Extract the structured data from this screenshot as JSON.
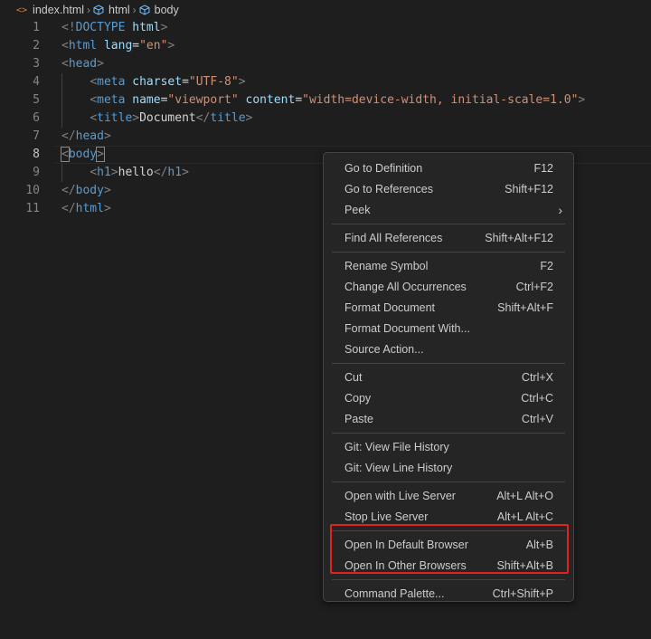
{
  "breadcrumb": {
    "file": "index.html",
    "items": [
      "html",
      "body"
    ]
  },
  "editor": {
    "line_numbers": [
      "1",
      "2",
      "3",
      "4",
      "5",
      "6",
      "7",
      "8",
      "9",
      "10",
      "11"
    ],
    "lines": [
      [
        [
          "p",
          "<!"
        ],
        [
          "t",
          "DOCTYPE"
        ],
        [
          "x",
          " "
        ],
        [
          "a",
          "html"
        ],
        [
          "p",
          ">"
        ]
      ],
      [
        [
          "p",
          "<"
        ],
        [
          "t",
          "html"
        ],
        [
          "x",
          " "
        ],
        [
          "a",
          "lang"
        ],
        [
          "x",
          "="
        ],
        [
          "s",
          "\"en\""
        ],
        [
          "p",
          ">"
        ]
      ],
      [
        [
          "p",
          "<"
        ],
        [
          "t",
          "head"
        ],
        [
          "p",
          ">"
        ]
      ],
      [
        [
          "x",
          "    "
        ],
        [
          "p",
          "<"
        ],
        [
          "t",
          "meta"
        ],
        [
          "x",
          " "
        ],
        [
          "a",
          "charset"
        ],
        [
          "x",
          "="
        ],
        [
          "s",
          "\"UTF-8\""
        ],
        [
          "p",
          ">"
        ]
      ],
      [
        [
          "x",
          "    "
        ],
        [
          "p",
          "<"
        ],
        [
          "t",
          "meta"
        ],
        [
          "x",
          " "
        ],
        [
          "a",
          "name"
        ],
        [
          "x",
          "="
        ],
        [
          "s",
          "\"viewport\""
        ],
        [
          "x",
          " "
        ],
        [
          "a",
          "content"
        ],
        [
          "x",
          "="
        ],
        [
          "s",
          "\"width=device-width, initial-scale=1.0\""
        ],
        [
          "p",
          ">"
        ]
      ],
      [
        [
          "x",
          "    "
        ],
        [
          "p",
          "<"
        ],
        [
          "t",
          "title"
        ],
        [
          "p",
          ">"
        ],
        [
          "x",
          "Document"
        ],
        [
          "p",
          "</"
        ],
        [
          "t",
          "title"
        ],
        [
          "p",
          ">"
        ]
      ],
      [
        [
          "p",
          "</"
        ],
        [
          "t",
          "head"
        ],
        [
          "p",
          ">"
        ]
      ],
      [
        [
          "p",
          "<"
        ],
        [
          "t",
          "body"
        ],
        [
          "p",
          ">"
        ]
      ],
      [
        [
          "x",
          "    "
        ],
        [
          "p",
          "<"
        ],
        [
          "t",
          "h1"
        ],
        [
          "p",
          ">"
        ],
        [
          "x",
          "hello"
        ],
        [
          "p",
          "</"
        ],
        [
          "t",
          "h1"
        ],
        [
          "p",
          ">"
        ]
      ],
      [
        [
          "p",
          "</"
        ],
        [
          "t",
          "body"
        ],
        [
          "p",
          ">"
        ]
      ],
      [
        [
          "p",
          "</"
        ],
        [
          "t",
          "html"
        ],
        [
          "p",
          ">"
        ]
      ]
    ]
  },
  "context_menu": {
    "groups": [
      [
        {
          "label": "Go to Definition",
          "shortcut": "F12"
        },
        {
          "label": "Go to References",
          "shortcut": "Shift+F12"
        },
        {
          "label": "Peek",
          "submenu": true
        }
      ],
      [
        {
          "label": "Find All References",
          "shortcut": "Shift+Alt+F12"
        }
      ],
      [
        {
          "label": "Rename Symbol",
          "shortcut": "F2"
        },
        {
          "label": "Change All Occurrences",
          "shortcut": "Ctrl+F2"
        },
        {
          "label": "Format Document",
          "shortcut": "Shift+Alt+F"
        },
        {
          "label": "Format Document With...",
          "shortcut": ""
        },
        {
          "label": "Source Action...",
          "shortcut": ""
        }
      ],
      [
        {
          "label": "Cut",
          "shortcut": "Ctrl+X"
        },
        {
          "label": "Copy",
          "shortcut": "Ctrl+C"
        },
        {
          "label": "Paste",
          "shortcut": "Ctrl+V"
        }
      ],
      [
        {
          "label": "Git: View File History",
          "shortcut": ""
        },
        {
          "label": "Git: View Line History",
          "shortcut": ""
        }
      ],
      [
        {
          "label": "Open with Live Server",
          "shortcut": "Alt+L Alt+O"
        },
        {
          "label": "Stop Live Server",
          "shortcut": "Alt+L Alt+C"
        }
      ],
      [
        {
          "label": "Open In Default Browser",
          "shortcut": "Alt+B"
        },
        {
          "label": "Open In Other Browsers",
          "shortcut": "Shift+Alt+B"
        }
      ],
      [
        {
          "label": "Command Palette...",
          "shortcut": "Ctrl+Shift+P"
        }
      ]
    ]
  },
  "colors": {
    "highlight_border": "#e0231f",
    "html_icon": "#e37933"
  }
}
